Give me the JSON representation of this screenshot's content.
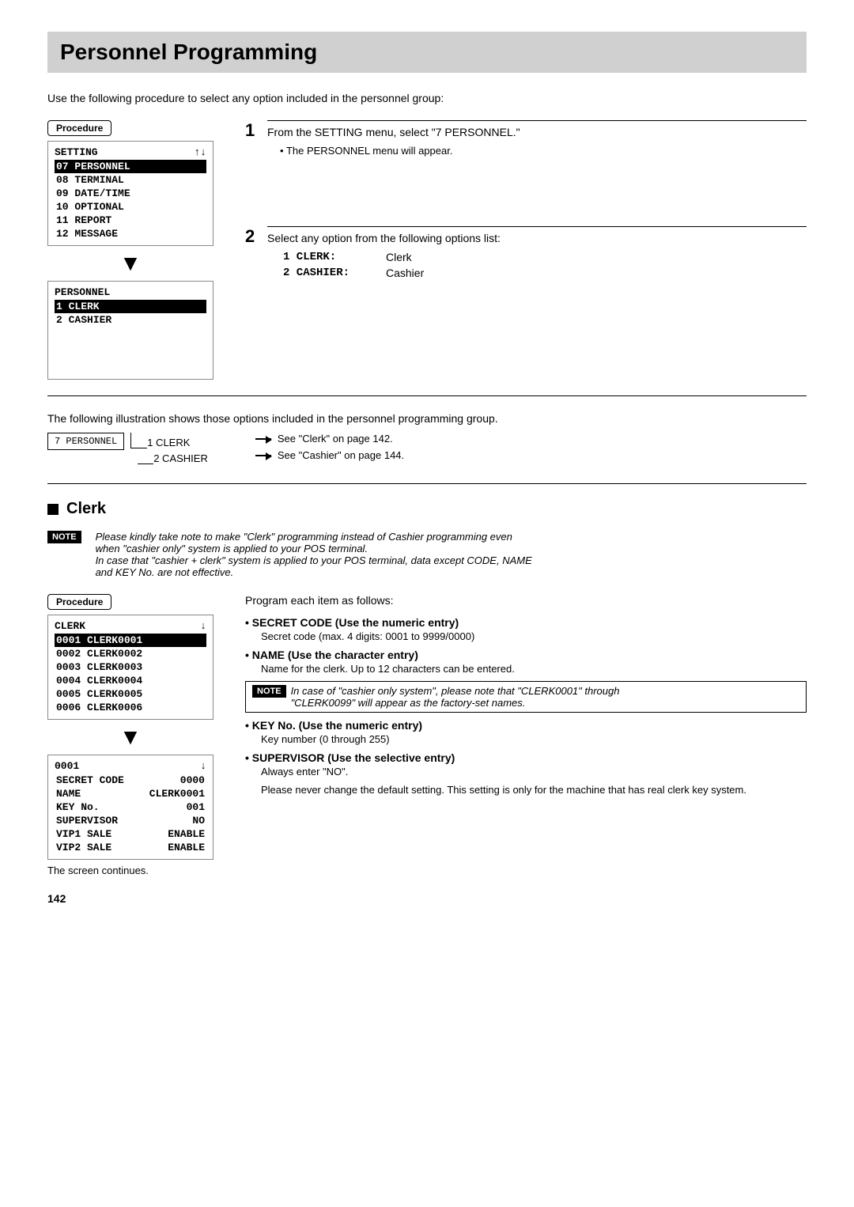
{
  "page": {
    "title": "Personnel Programming",
    "intro": "Use the following procedure to select any option included in the personnel group:",
    "procedure_label": "Procedure",
    "section1": {
      "screen1": {
        "header_label": "SETTING",
        "header_arrows": "↑↓",
        "highlighted_row": "07 PERSONNEL",
        "rows": [
          "08 TERMINAL",
          "09 DATE/TIME",
          "10 OPTIONAL",
          "11 REPORT",
          "12 MESSAGE"
        ]
      },
      "step1": {
        "number": "1",
        "text": "From the SETTING menu, select \"7 PERSONNEL.\"",
        "bullet": "The PERSONNEL menu will appear."
      },
      "screen2": {
        "header_label": "PERSONNEL",
        "highlighted_row": "1 CLERK",
        "rows": [
          "2 CASHIER"
        ]
      },
      "step2": {
        "number": "2",
        "text": "Select any option from the following options list:",
        "options": [
          {
            "code": "1 CLERK:",
            "value": "Clerk"
          },
          {
            "code": "2 CASHIER:",
            "value": "Cashier"
          }
        ]
      }
    },
    "illustration": {
      "text": "The following illustration shows those options included in the personnel programming group.",
      "diagram_box": "7 PERSONNEL",
      "tree": [
        "1 CLERK",
        "2 CASHIER"
      ],
      "refs": [
        {
          "text": "See \"Clerk\" on page 142."
        },
        {
          "text": "See \"Cashier\" on page 144."
        }
      ]
    },
    "clerk_section": {
      "title": "Clerk",
      "note": {
        "label": "NOTE",
        "lines": [
          "Please kindly take note to make \"Clerk\" programming instead of Cashier programming even",
          "when \"cashier only\" system is applied to your POS terminal.",
          "In case that \"cashier + clerk\" system is applied to your POS terminal, data except CODE, NAME",
          "and KEY No. are not effective."
        ]
      },
      "procedure_label": "Procedure",
      "program_text": "Program each item as follows:",
      "screen3": {
        "header_label": "CLERK",
        "header_arrow": "↓",
        "highlighted_row": "0001 CLERK0001",
        "rows": [
          "0002 CLERK0002",
          "0003 CLERK0003",
          "0004 CLERK0004",
          "0005 CLERK0005",
          "0006 CLERK0006"
        ]
      },
      "screen4": {
        "header_label": "0001",
        "header_arrow": "↓",
        "rows": [
          {
            "label": "SECRET CODE",
            "value": "0000"
          },
          {
            "label": "NAME",
            "value": "CLERK0001"
          },
          {
            "label": "KEY No.",
            "value": "001"
          },
          {
            "label": "SUPERVISOR",
            "value": "NO"
          },
          {
            "label": "VIP1 SALE",
            "value": "ENABLE"
          },
          {
            "label": "VIP2 SALE",
            "value": "ENABLE"
          }
        ]
      },
      "items": [
        {
          "title": "SECRET CODE (Use the numeric entry)",
          "desc": "Secret code (max. 4 digits: 0001 to 9999/0000)"
        },
        {
          "title": "NAME (Use the character entry)",
          "desc": "Name for the clerk.  Up to 12 characters can be entered."
        }
      ],
      "note2": {
        "label": "NOTE",
        "lines": [
          "In case of \"cashier only system\", please note that \"CLERK0001\" through",
          "\"CLERK0099\" will appear as the factory-set names."
        ]
      },
      "items2": [
        {
          "title": "KEY No. (Use the numeric entry)",
          "desc": "Key number (0 through 255)"
        },
        {
          "title": "SUPERVISOR (Use the selective entry)",
          "desc1": "Always enter \"NO\".",
          "desc2": "Please never change the default setting. This setting is only for the machine that has real clerk key system."
        }
      ],
      "continues": "The screen continues.",
      "page_number": "142"
    }
  }
}
